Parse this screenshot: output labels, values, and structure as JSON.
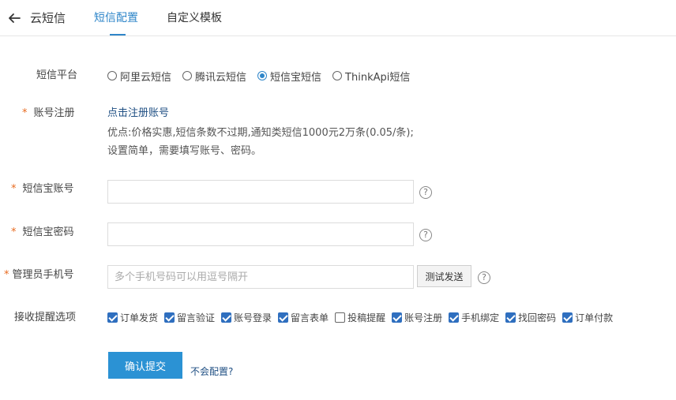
{
  "header": {
    "back_icon": "arrow-left-icon",
    "title": "云短信",
    "tabs": [
      {
        "label": "短信配置",
        "active": true
      },
      {
        "label": "自定义模板",
        "active": false
      }
    ],
    "accent_color": "#2f86c9"
  },
  "form": {
    "platform": {
      "label": "短信平台",
      "options": [
        {
          "label": "阿里云短信",
          "selected": false
        },
        {
          "label": "腾讯云短信",
          "selected": false
        },
        {
          "label": "短信宝短信",
          "selected": true
        },
        {
          "label": "ThinkApi短信",
          "selected": false
        }
      ]
    },
    "register": {
      "required_mark": "*",
      "label": "账号注册",
      "link": "点击注册账号",
      "info_lines": [
        "优点:价格实惠,短信条数不过期,通知类短信1000元2万条(0.05/条);",
        "设置简单，需要填写账号、密码。"
      ]
    },
    "account": {
      "required_mark": "*",
      "label": "短信宝账号",
      "value": "",
      "placeholder": "",
      "help_icon": "question-circle-icon"
    },
    "password": {
      "required_mark": "*",
      "label": "短信宝密码",
      "value": "",
      "placeholder": "",
      "help_icon": "question-circle-icon"
    },
    "admin_phone": {
      "required_mark": "*",
      "label": "管理员手机号",
      "value": "",
      "placeholder": "多个手机号码可以用逗号隔开",
      "test_button": "测试发送",
      "help_icon": "question-circle-icon"
    },
    "reminders": {
      "label": "接收提醒选项",
      "options": [
        {
          "label": "订单发货",
          "checked": true
        },
        {
          "label": "留言验证",
          "checked": true
        },
        {
          "label": "账号登录",
          "checked": true
        },
        {
          "label": "留言表单",
          "checked": true
        },
        {
          "label": "投稿提醒",
          "checked": false
        },
        {
          "label": "账号注册",
          "checked": true
        },
        {
          "label": "手机绑定",
          "checked": true
        },
        {
          "label": "找回密码",
          "checked": true
        },
        {
          "label": "订单付款",
          "checked": true
        }
      ]
    },
    "submit_label": "确认提交",
    "help_link": "不会配置?",
    "required_color": "#e86a1f",
    "primary_button_color": "#2b92d4"
  }
}
